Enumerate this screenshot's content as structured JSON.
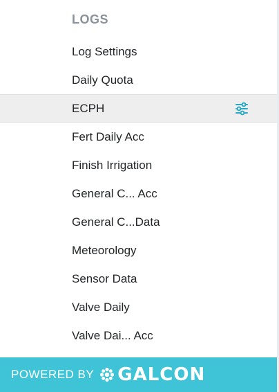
{
  "section": {
    "title": "LOGS"
  },
  "menu": {
    "items": [
      {
        "label": "Log Settings"
      },
      {
        "label": "Daily Quota"
      },
      {
        "label": "ECPH",
        "active": true,
        "icon": "settings-sliders-icon"
      },
      {
        "label": "Fert Daily Acc"
      },
      {
        "label": "Finish Irrigation"
      },
      {
        "label": "General C... Acc"
      },
      {
        "label": "General C...Data"
      },
      {
        "label": "Meteorology"
      },
      {
        "label": "Sensor Data"
      },
      {
        "label": "Valve Daily"
      },
      {
        "label": "Valve Dai... Acc"
      }
    ]
  },
  "footer": {
    "powered_by": "POWERED BY",
    "brand": "GALCON",
    "brand_icon": "galcon-logo-icon"
  },
  "colors": {
    "accent": "#3ec4d6",
    "active_bg": "#eeeeee",
    "text": "#222629",
    "header_text": "#8a9199",
    "icon": "#29a8c4"
  }
}
